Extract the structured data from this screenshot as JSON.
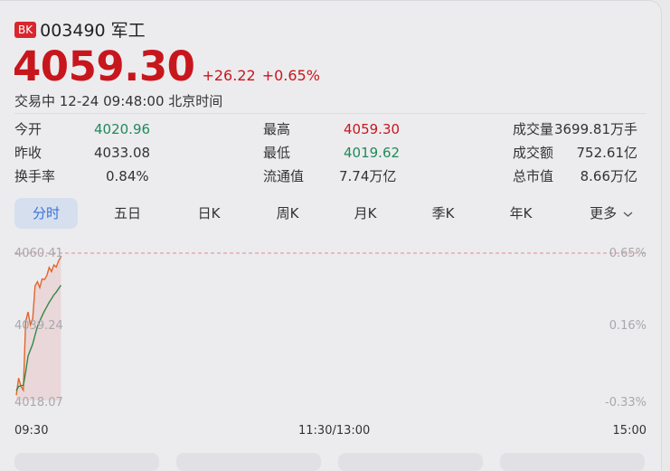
{
  "header": {
    "badge": "BK",
    "title": "003490 军工"
  },
  "quote": {
    "price": "4059.30",
    "change": "+26.22",
    "change_pct": "+0.65%",
    "status": "交易中 12-24 09:48:00 北京时间"
  },
  "stats": [
    {
      "label": "今开",
      "value": "4020.96",
      "tone": "green"
    },
    {
      "label": "最高",
      "value": "4059.30",
      "tone": "red"
    },
    {
      "label": "成交量",
      "value": "3699.81万手",
      "tone": "dark"
    },
    {
      "label": "昨收",
      "value": "4033.08",
      "tone": "dark"
    },
    {
      "label": "最低",
      "value": "4019.62",
      "tone": "green"
    },
    {
      "label": "成交额",
      "value": "752.61亿",
      "tone": "dark"
    },
    {
      "label": "换手率",
      "value": "0.84%",
      "tone": "dark"
    },
    {
      "label": "流通值",
      "value": "7.74万亿",
      "tone": "dark"
    },
    {
      "label": "总市值",
      "value": "8.66万亿",
      "tone": "dark"
    }
  ],
  "periods": [
    "分时",
    "五日",
    "日K",
    "周K",
    "月K",
    "季K",
    "年K",
    "更多"
  ],
  "active_period": "分时",
  "chart": {
    "y_labels": [
      "4060.41",
      "4039.24",
      "4018.07"
    ],
    "pct_labels": [
      "0.65%",
      "0.16%",
      "-0.33%"
    ],
    "time_labels": [
      "09:30",
      "11:30/13:00",
      "15:00"
    ]
  },
  "colors": {
    "up": "#c8161d",
    "down": "#1f8a5b",
    "active_tab": "#3973d8",
    "price_line": "#e2662a",
    "avg_line": "#2e8a45"
  },
  "chart_data": {
    "type": "line",
    "ylim": [
      4018.07,
      4060.41
    ],
    "series": [
      {
        "values": [
          4019.6,
          4024.5,
          4022.1,
          4021.0,
          4040.8,
          4043.5,
          4039.8,
          4041.5,
          4051.0,
          4052.2,
          4050.5,
          4053.0,
          4052.8,
          4054.0,
          4056.3,
          4055.1,
          4057.0,
          4056.4,
          4058.2,
          4059.3
        ]
      },
      {
        "values": [
          4020.9,
          4022.1,
          4022.3,
          4022.4,
          4026.2,
          4030.8,
          4032.6,
          4034.3,
          4036.9,
          4039.3,
          4040.9,
          4042.4,
          4043.8,
          4045.0,
          4046.3,
          4047.3,
          4048.4,
          4049.2,
          4050.2,
          4051.2
        ]
      }
    ]
  }
}
